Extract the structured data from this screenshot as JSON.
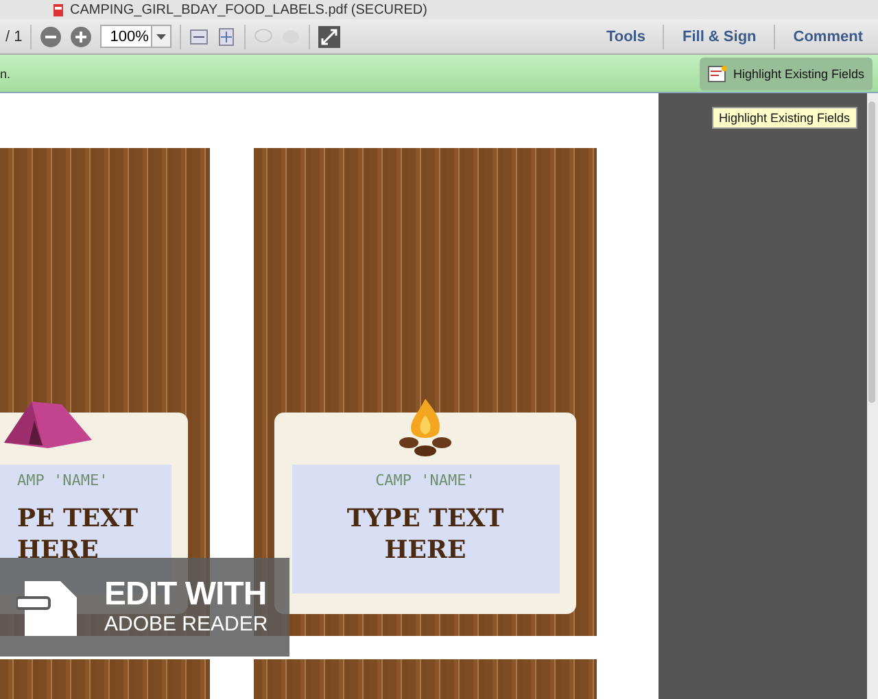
{
  "window": {
    "title": "CAMPING_GIRL_BDAY_FOOD_LABELS.pdf (SECURED)"
  },
  "toolbar": {
    "page_count": "/ 1",
    "zoom": "100%",
    "tabs": [
      {
        "label": "Tools"
      },
      {
        "label": "Fill & Sign"
      },
      {
        "label": "Comment"
      }
    ]
  },
  "notice_bar": {
    "message": "n.",
    "button": "Highlight Existing Fields"
  },
  "tooltip": "Highlight Existing Fields",
  "labels": [
    {
      "kind": "tent",
      "caption": "AMP 'NAME'",
      "field_text": "PE TEXT HERE"
    },
    {
      "kind": "campfire",
      "caption": "CAMP 'NAME'",
      "field_text": "TYPE TEXT HERE"
    }
  ],
  "banner": {
    "line_1": "EDIT WITH",
    "line_2": "ADOBE READER"
  }
}
